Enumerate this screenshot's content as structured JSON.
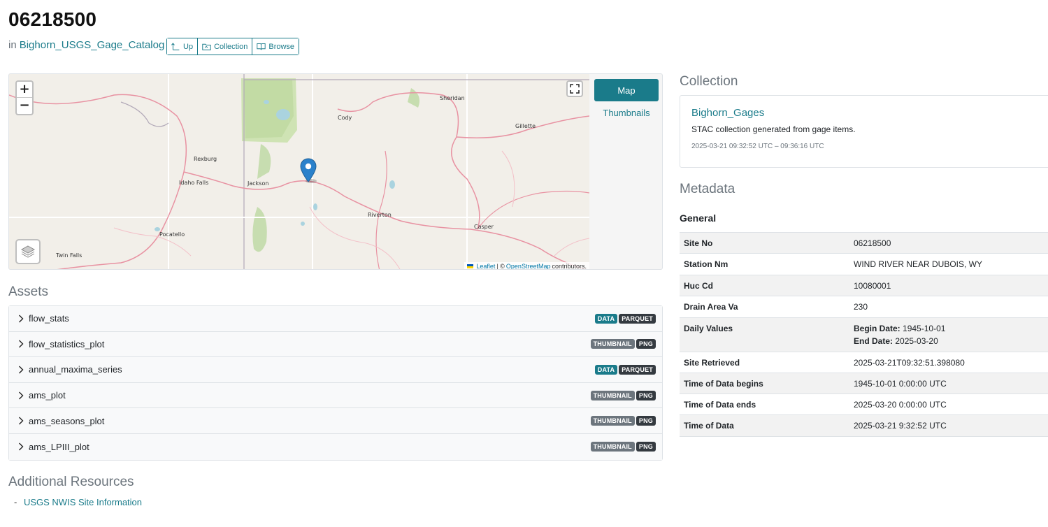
{
  "header": {
    "title": "06218500",
    "in_prefix": "in",
    "parent_link": "Bighorn_USGS_Gage_Catalog",
    "buttons": {
      "up": "Up",
      "collection": "Collection",
      "browse": "Browse"
    }
  },
  "map": {
    "zoom_in": "+",
    "zoom_out": "−",
    "tabs": [
      "Map",
      "Thumbnails"
    ],
    "attribution": {
      "leaflet": "Leaflet",
      "separator": "| ©",
      "osm": "OpenStreetMap",
      "suffix": "contributors."
    },
    "labels": [
      "Sheridan",
      "Cody",
      "Gillette",
      "Rexburg",
      "Idaho Falls",
      "Jackson",
      "Riverton",
      "Casper",
      "Pocatello",
      "Twin Falls"
    ]
  },
  "assets": {
    "heading": "Assets",
    "items": [
      {
        "name": "flow_stats",
        "badges": [
          {
            "text": "DATA",
            "color": "#1a7b8a"
          },
          {
            "text": "PARQUET",
            "color": "#343a40"
          }
        ]
      },
      {
        "name": "flow_statistics_plot",
        "badges": [
          {
            "text": "THUMBNAIL",
            "color": "#6c757d"
          },
          {
            "text": "PNG",
            "color": "#343a40"
          }
        ]
      },
      {
        "name": "annual_maxima_series",
        "badges": [
          {
            "text": "DATA",
            "color": "#1a7b8a"
          },
          {
            "text": "PARQUET",
            "color": "#343a40"
          }
        ]
      },
      {
        "name": "ams_plot",
        "badges": [
          {
            "text": "THUMBNAIL",
            "color": "#6c757d"
          },
          {
            "text": "PNG",
            "color": "#343a40"
          }
        ]
      },
      {
        "name": "ams_seasons_plot",
        "badges": [
          {
            "text": "THUMBNAIL",
            "color": "#6c757d"
          },
          {
            "text": "PNG",
            "color": "#343a40"
          }
        ]
      },
      {
        "name": "ams_LPIII_plot",
        "badges": [
          {
            "text": "THUMBNAIL",
            "color": "#6c757d"
          },
          {
            "text": "PNG",
            "color": "#343a40"
          }
        ]
      }
    ]
  },
  "additional_resources": {
    "heading": "Additional Resources",
    "bullet": "-",
    "links": [
      "USGS NWIS Site Information"
    ]
  },
  "collection": {
    "heading": "Collection",
    "title": "Bighorn_Gages",
    "description": "STAC collection generated from gage items.",
    "time_range": "2025-03-21 09:32:52 UTC – 09:36:16 UTC"
  },
  "metadata": {
    "heading": "Metadata",
    "subheading": "General",
    "rows": [
      {
        "key": "Site No",
        "value": "06218500"
      },
      {
        "key": "Station Nm",
        "value": "WIND RIVER NEAR DUBOIS, WY"
      },
      {
        "key": "Huc Cd",
        "value": "10080001"
      },
      {
        "key": "Drain Area Va",
        "value": "230"
      },
      {
        "key": "Daily Values",
        "value": "",
        "begin_label": "Begin Date:",
        "begin_value": "1945-10-01",
        "end_label": "End Date:",
        "end_value": "2025-03-20"
      },
      {
        "key": "Site Retrieved",
        "value": "2025-03-21T09:32:51.398080"
      },
      {
        "key": "Time of Data begins",
        "value": "1945-10-01 0:00:00 UTC"
      },
      {
        "key": "Time of Data ends",
        "value": "2025-03-20 0:00:00 UTC"
      },
      {
        "key": "Time of Data",
        "value": "2025-03-21 9:32:52 UTC"
      }
    ]
  },
  "colors": {
    "accent": "#1a7b8a",
    "muted": "#6c757d",
    "dark_badge": "#343a40",
    "marker": "#2a81cb"
  }
}
